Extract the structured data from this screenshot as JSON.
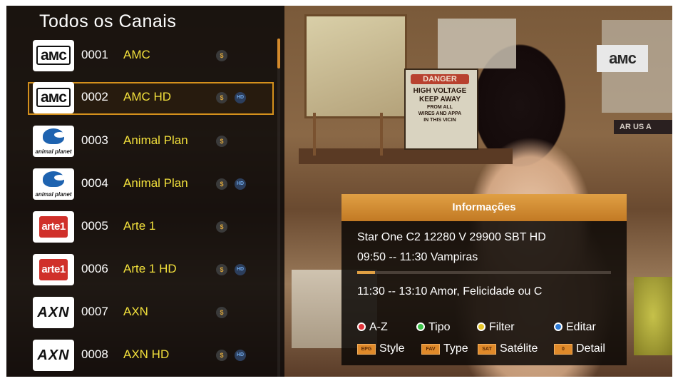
{
  "channel_list": {
    "title": "Todos os Canais",
    "selected_index": 1,
    "channels": [
      {
        "logo": "AMC",
        "logo_text": "aмc",
        "number": "0001",
        "name": "AMC",
        "has_coin": true,
        "has_hd": false
      },
      {
        "logo": "AMC",
        "logo_text": "aмc",
        "number": "0002",
        "name": "AMC HD",
        "has_coin": true,
        "has_hd": true
      },
      {
        "logo": "Animal Planet",
        "logo_text": "animal planet",
        "number": "0003",
        "name": "Animal Plan",
        "has_coin": true,
        "has_hd": false
      },
      {
        "logo": "Animal Planet",
        "logo_text": "animal planet",
        "number": "0004",
        "name": "Animal Plan",
        "has_coin": true,
        "has_hd": true
      },
      {
        "logo": "Arte 1",
        "logo_text": "arte1",
        "number": "0005",
        "name": "Arte 1",
        "has_coin": true,
        "has_hd": false
      },
      {
        "logo": "Arte 1",
        "logo_text": "arte1",
        "number": "0006",
        "name": "Arte 1 HD",
        "has_coin": true,
        "has_hd": true
      },
      {
        "logo": "AXN",
        "logo_text": "AXN",
        "number": "0007",
        "name": "AXN",
        "has_coin": true,
        "has_hd": false
      },
      {
        "logo": "AXN",
        "logo_text": "AXN",
        "number": "0008",
        "name": "AXN HD",
        "has_coin": true,
        "has_hd": true
      }
    ],
    "coin_glyph": "$",
    "hd_glyph": "HD"
  },
  "watermark": {
    "text": "aмc"
  },
  "scene": {
    "danger_sign": [
      "DANGER",
      "HIGH VOLTAGE",
      "KEEP AWAY",
      "FROM ALL",
      "WIRES AND APPA",
      "IN THIS VICIN"
    ],
    "right_sign": "AR US A"
  },
  "info": {
    "title": "Informações",
    "transponder": "Star One C2  12280 V 29900  SBT HD",
    "now": "09:50 -- 11:30 Vampiras",
    "now_progress": 0.07,
    "next": "11:30 -- 13:10 Amor, Felicidade ou C",
    "buttons": [
      {
        "color": "#e0343a",
        "label": "A-Z"
      },
      {
        "color": "#3cc24a",
        "label": "Tipo"
      },
      {
        "color": "#e6c52a",
        "label": "Filter"
      },
      {
        "color": "#2c7ad6",
        "label": "Editar"
      }
    ],
    "keys": [
      {
        "tag": "EPG",
        "label": "Style"
      },
      {
        "tag": "FAV",
        "label": "Type"
      },
      {
        "tag": "SAT",
        "label": "Satélite"
      },
      {
        "tag": "0",
        "label": "Detail"
      }
    ]
  }
}
